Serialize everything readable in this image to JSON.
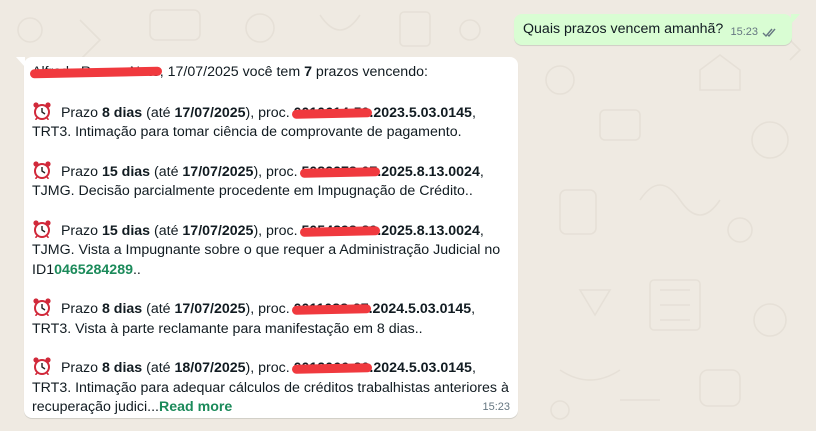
{
  "outgoing": {
    "text": "Quais prazos vencem amanhã?",
    "time": "15:23",
    "status_icon": "double-check-icon"
  },
  "incoming": {
    "greeting_name": "Alfredo Ramos Neto",
    "greeting_mid": ", 17/07/2025 você tem ",
    "greeting_count": "7",
    "greeting_end": " prazos vencendo:",
    "time": "15:23",
    "read_more": "Read more",
    "items": [
      {
        "icon": "alarm-clock-icon",
        "prefix": " Prazo ",
        "days": "8 dias",
        "ate": " (até ",
        "date": "17/07/2025",
        "proc_label": "), proc. ",
        "proc_hidden": "0010614-50",
        "proc_visible": ".2023.5.03.0145",
        "after": ",",
        "line2": "TRT3. Intimação para tomar ciência de comprovante de pagamento."
      },
      {
        "icon": "alarm-clock-icon",
        "prefix": " Prazo ",
        "days": "15 dias",
        "ate": " (até ",
        "date": "17/07/2025",
        "proc_label": "), proc. ",
        "proc_hidden": "5082278-07",
        "proc_visible": ".2025.8.13.0024",
        "after": ",",
        "line2": "TJMG. Decisão parcialmente procedente em Impugnação de Crédito.."
      },
      {
        "icon": "alarm-clock-icon",
        "prefix": " Prazo ",
        "days": "15 dias",
        "ate": " (até ",
        "date": "17/07/2025",
        "proc_label": "), proc. ",
        "proc_hidden": "5054898-89",
        "proc_visible": ".2025.8.13.0024",
        "after": ",",
        "line2": "TJMG. Vista a Impugnante sobre o que requer a Administração Judicial no",
        "line3_prefix": "ID1",
        "line3_link": "0465284289",
        "line3_suffix": ".."
      },
      {
        "icon": "alarm-clock-icon",
        "prefix": " Prazo ",
        "days": "8 dias",
        "ate": " (até ",
        "date": "17/07/2025",
        "proc_label": "), proc. ",
        "proc_hidden": "0011088-27",
        "proc_visible": ".2024.5.03.0145",
        "after": ",",
        "line2": "TRT3. Vista à parte reclamante para manifestação em 8 dias.."
      },
      {
        "icon": "alarm-clock-icon",
        "prefix": " Prazo ",
        "days": "8 dias",
        "ate": " (até ",
        "date": "18/07/2025",
        "proc_label": "), proc. ",
        "proc_hidden": "0012066-30",
        "proc_visible": ".2024.5.03.0145",
        "after": ",",
        "line2": "TRT3. Intimação para adequar cálculos de créditos trabalhistas anteriores à",
        "line3_prefix": "recuperação judici",
        "line3_ellipsis": "..."
      }
    ]
  },
  "colors": {
    "background": "#efeae2",
    "outgoing_bubble": "#d9fdd3",
    "incoming_bubble": "#ffffff",
    "redaction": "#f0393e",
    "link": "#1b8a5a"
  }
}
